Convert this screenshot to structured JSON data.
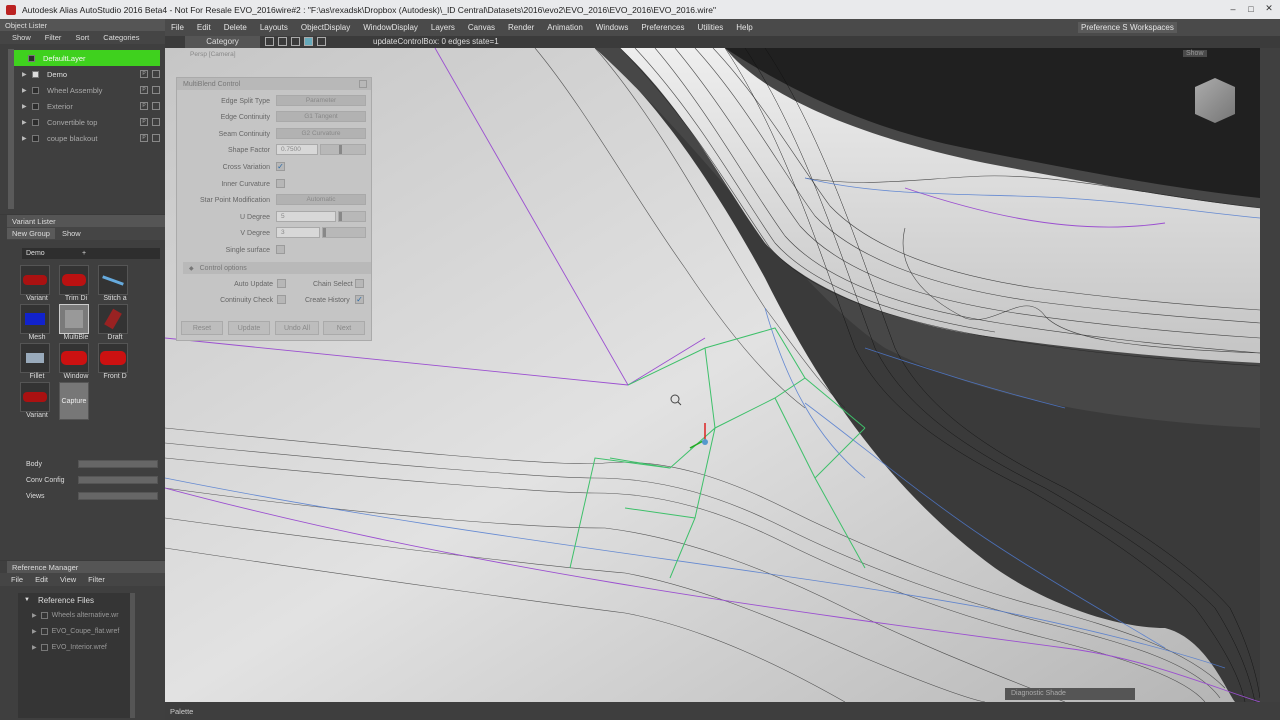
{
  "titlebar": {
    "text": "Autodesk Alias AutoStudio 2016 Beta4 - Not For Resale  EVO_2016wire#2 : \"F:\\as\\rexadsk\\Dropbox (Autodesk)\\_ID Central\\Datasets\\2016\\evo2\\EVO_2016\\EVO_2016\\EVO_2016.wire\""
  },
  "menu": [
    "File",
    "Edit",
    "Delete",
    "Layouts",
    "ObjectDisplay",
    "WindowDisplay",
    "Layers",
    "Canvas",
    "Render",
    "Animation",
    "Windows",
    "Preferences",
    "Utilities",
    "Help"
  ],
  "toolbar": {
    "category": "Category",
    "status": "updateControlBox: 0 edges state=1",
    "preference_sets": "Preference Sets",
    "workspaces": "Workspaces"
  },
  "viewport": {
    "label": "Persp [Camera]",
    "show": "Show",
    "diagnostic": "Diagnostic Shade"
  },
  "object_lister": {
    "title": "Object Lister",
    "menu": [
      "Show",
      "Filter",
      "Sort",
      "Categories"
    ],
    "layers": [
      {
        "name": "DefaultLayer",
        "active": true
      },
      {
        "name": "Demo"
      },
      {
        "name": "Wheel Assembly"
      },
      {
        "name": "Exterior"
      },
      {
        "name": "Convertible top"
      },
      {
        "name": "coupe blackout"
      }
    ]
  },
  "variant_lister": {
    "title": "Variant Lister",
    "tabs": [
      "New Group",
      "Show"
    ],
    "group": "Demo",
    "thumbs": [
      "Variant",
      "Trim Di",
      "Stitch a",
      "Mesh",
      "MultiBle",
      "Draft",
      "Fillet",
      "Window",
      "Front D",
      "Variant",
      "Capture"
    ],
    "groups": [
      "Body",
      "Conv Config",
      "Views"
    ]
  },
  "reference_manager": {
    "title": "Reference Manager",
    "menu": [
      "File",
      "Edit",
      "View",
      "Filter"
    ],
    "root": "Reference Files",
    "files": [
      "Wheels alternative.wr",
      "EVO_Coupe_flat.wref",
      "EVO_Interior.wref"
    ]
  },
  "multiblend": {
    "title": "MultiBlend Control",
    "edge_split_type": "Parameter",
    "edge_continuity": "G1 Tangent",
    "seam_continuity": "G2 Curvature",
    "shape_factor": "0.7500",
    "star_point_mod": "Automatic",
    "u_degree": "5",
    "v_degree": "3",
    "labels": {
      "edge_split": "Edge Split Type",
      "edge_cont": "Edge Continuity",
      "seam_cont": "Seam Continuity",
      "shape": "Shape Factor",
      "cross": "Cross Variation",
      "inner": "Inner Curvature",
      "star": "Star Point Modification",
      "u": "U Degree",
      "v": "V Degree",
      "single": "Single surface",
      "control": "Control options",
      "auto": "Auto Update",
      "chain": "Chain Select",
      "cont_check": "Continuity Check",
      "history": "Create History"
    },
    "buttons": [
      "Reset",
      "Update",
      "Undo All",
      "Next"
    ]
  },
  "palette": "Palette",
  "colors": {
    "accent_green": "#3fd11e",
    "menubar": "#4a4a4a",
    "panel": "#3f3f3f"
  }
}
